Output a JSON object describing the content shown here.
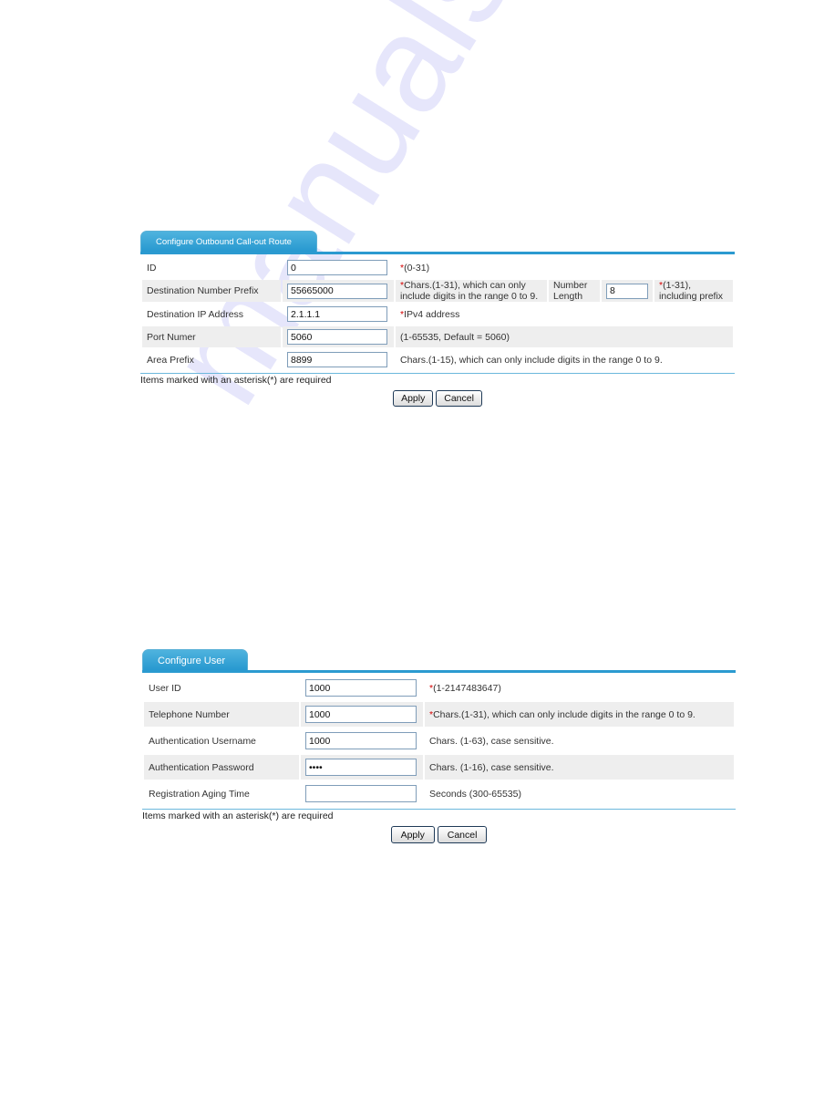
{
  "watermark": "manualshive.com",
  "outbound_route": {
    "tab_title": "Configure Outbound Call-out Route",
    "rows": {
      "id": {
        "label": "ID",
        "value": "0",
        "required": "*",
        "hint": "(0-31)"
      },
      "dest_prefix": {
        "label": "Destination Number Prefix",
        "value": "55665000",
        "required": "*",
        "hint": "Chars.(1-31), which can only include digits in the range 0 to 9."
      },
      "number_length": {
        "label": "Number Length",
        "value": "8",
        "required": "*",
        "hint": "(1-31), including prefix"
      },
      "dest_ip": {
        "label": "Destination IP Address",
        "value": "2.1.1.1",
        "required": "*",
        "hint": "IPv4 address"
      },
      "port": {
        "label": "Port Numer",
        "value": "5060",
        "hint": "(1-65535, Default = 5060)"
      },
      "area_prefix": {
        "label": "Area Prefix",
        "value": "8899",
        "hint": "Chars.(1-15), which can only include digits in the range 0 to 9."
      }
    },
    "note": "Items marked with an asterisk(*) are required",
    "apply_label": "Apply",
    "cancel_label": "Cancel"
  },
  "configure_user": {
    "tab_title": "Configure User",
    "rows": {
      "user_id": {
        "label": "User ID",
        "value": "1000",
        "required": "*",
        "hint": "(1-2147483647)"
      },
      "telephone": {
        "label": "Telephone Number",
        "value": "1000",
        "required": "*",
        "hint": "Chars.(1-31), which can only include digits in the range 0 to 9."
      },
      "auth_username": {
        "label": "Authentication Username",
        "value": "1000",
        "hint": "Chars. (1-63), case sensitive."
      },
      "auth_password": {
        "label": "Authentication Password",
        "value": "1000",
        "hint": "Chars. (1-16), case sensitive."
      },
      "aging_time": {
        "label": "Registration Aging Time",
        "value": "",
        "hint": "Seconds (300-65535)"
      }
    },
    "note": "Items marked with an asterisk(*) are required",
    "apply_label": "Apply",
    "cancel_label": "Cancel"
  }
}
